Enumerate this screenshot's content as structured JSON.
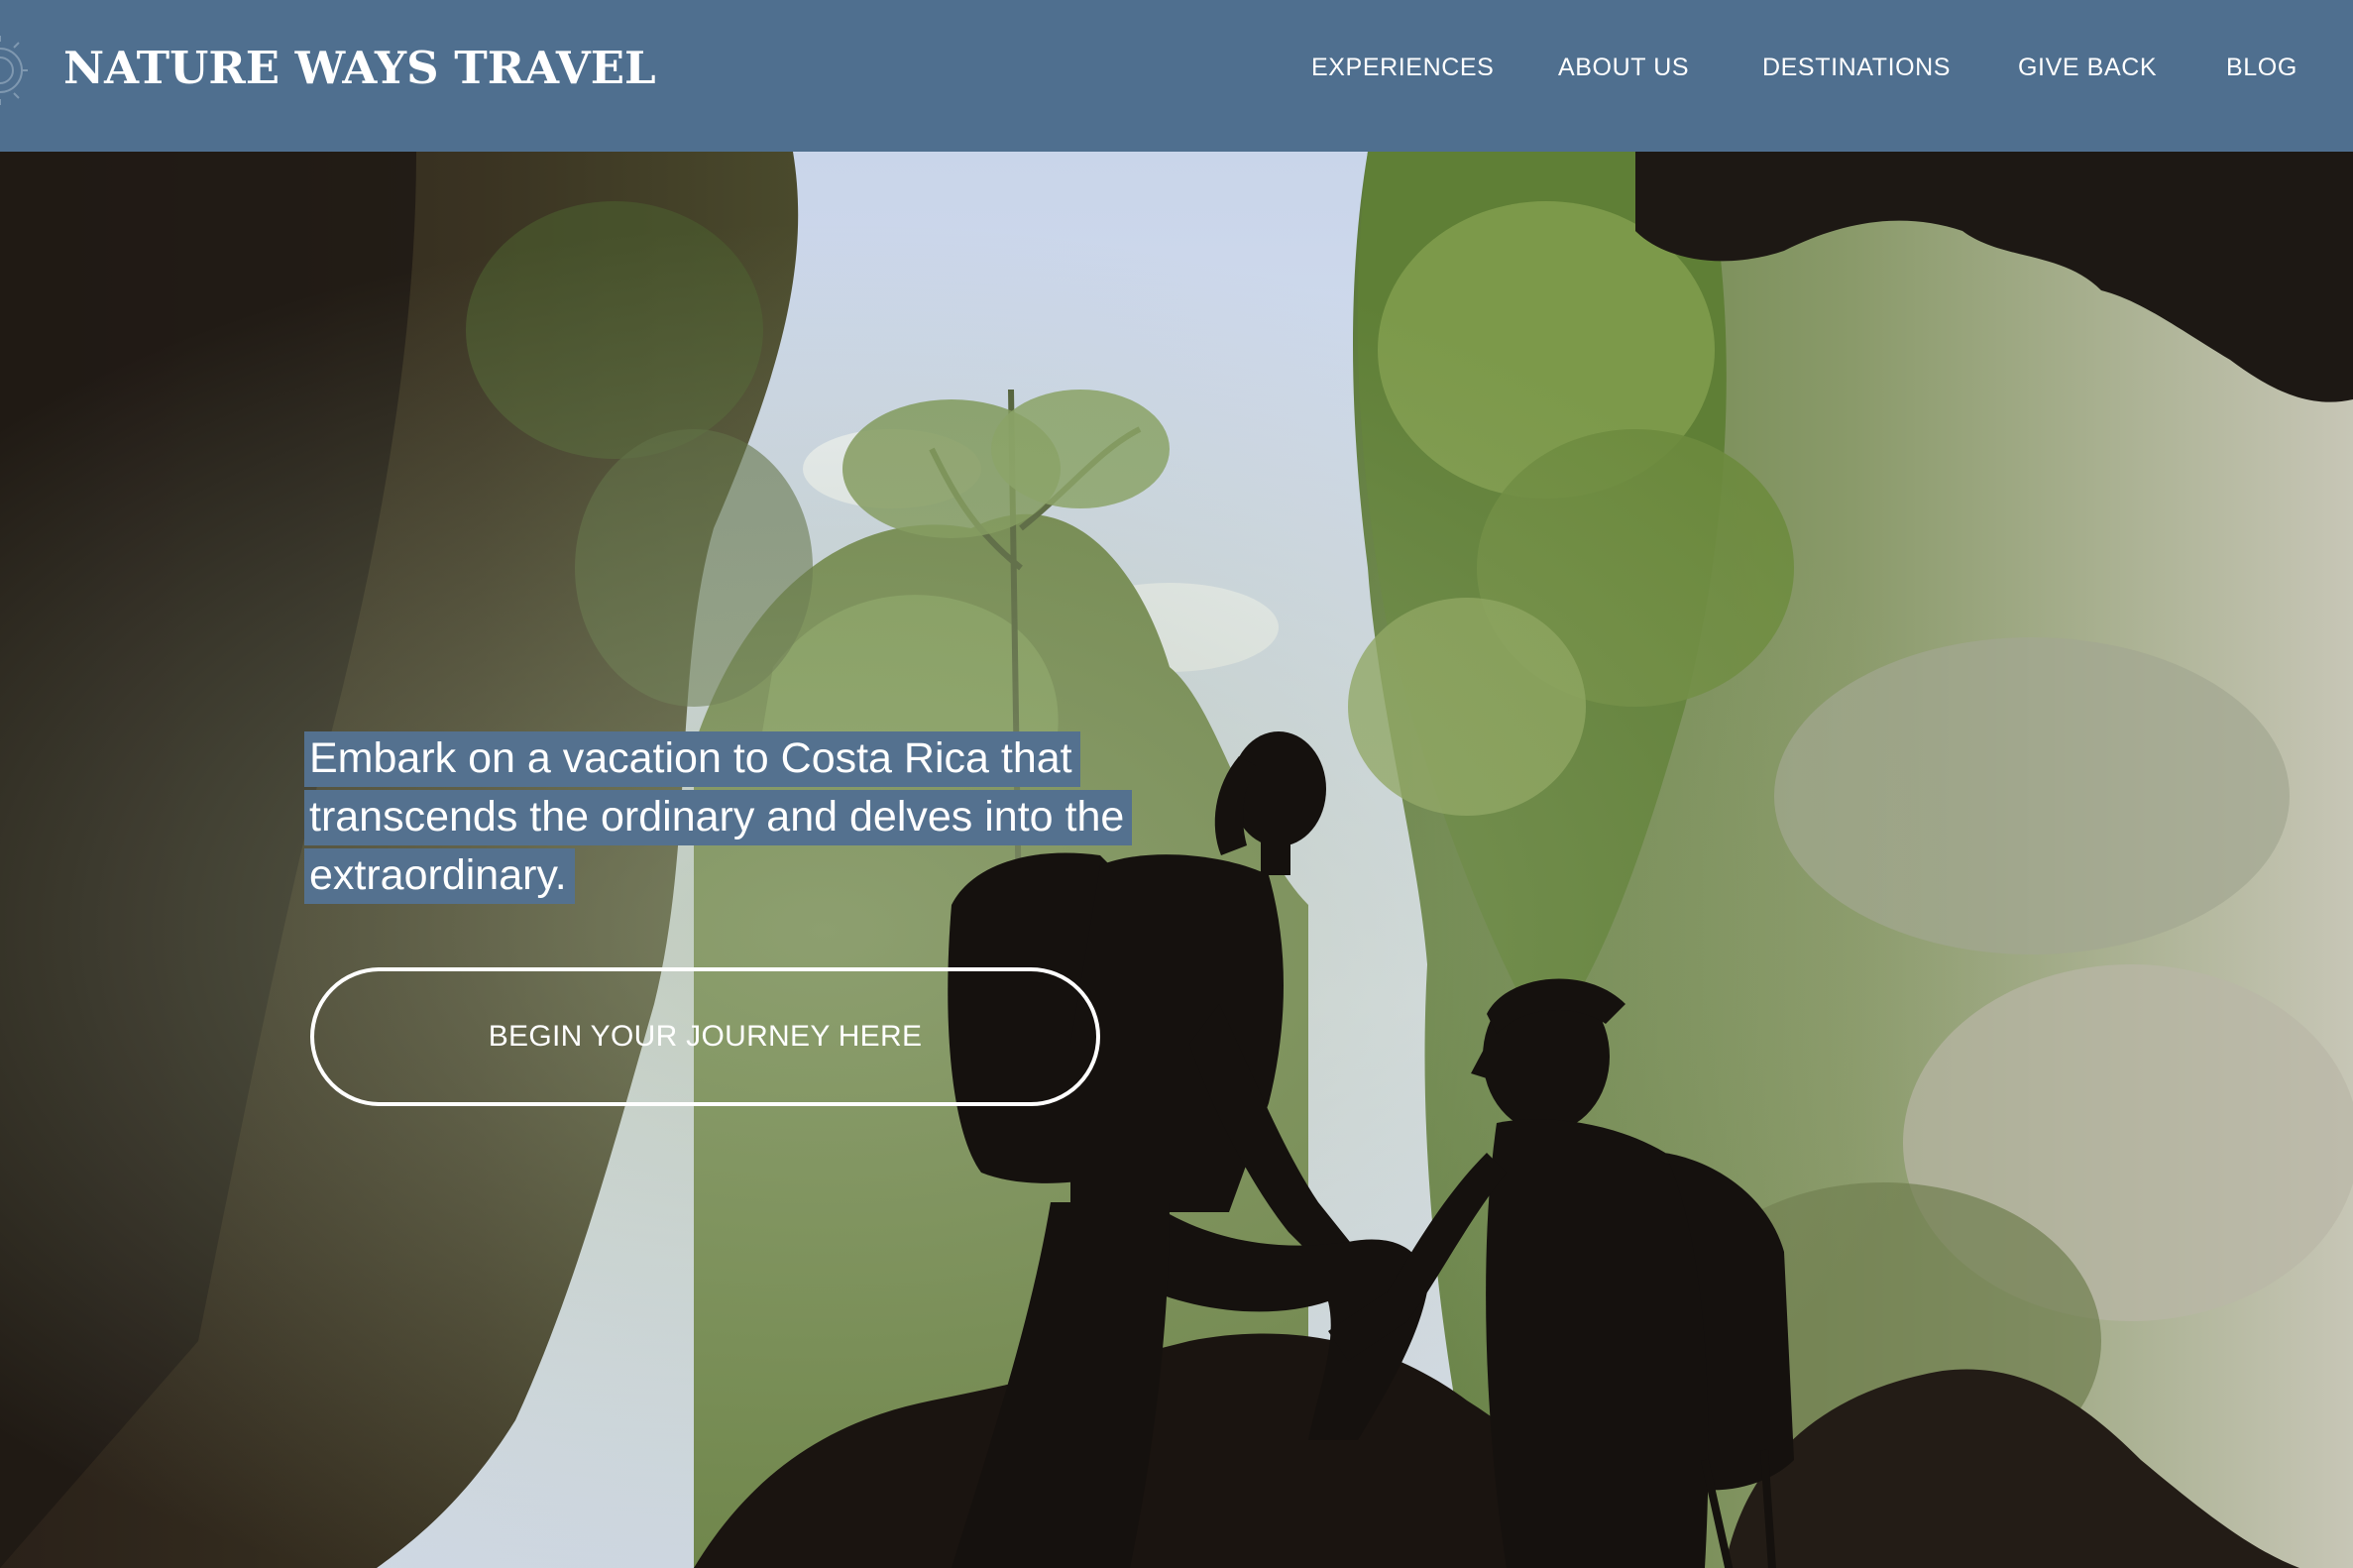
{
  "brand": {
    "name": "NATURE WAYS TRAVEL",
    "emblem_icon": "sun-emblem-icon"
  },
  "nav": {
    "items": [
      {
        "label": "EXPERIENCES"
      },
      {
        "label": "ABOUT US"
      },
      {
        "label": "DESTINATIONS"
      },
      {
        "label": "GIVE BACK"
      },
      {
        "label": "BLOG"
      }
    ]
  },
  "hero": {
    "tagline_lines": [
      "Embark on a vacation to Costa Rica that",
      "transcends the ordinary and delves into the",
      "extraordinary."
    ],
    "cta_label": "BEGIN YOUR JOURNEY HERE"
  },
  "colors": {
    "header_bg": "#4f6f8f",
    "tagline_highlight": "#54718f",
    "text": "#ffffff"
  }
}
